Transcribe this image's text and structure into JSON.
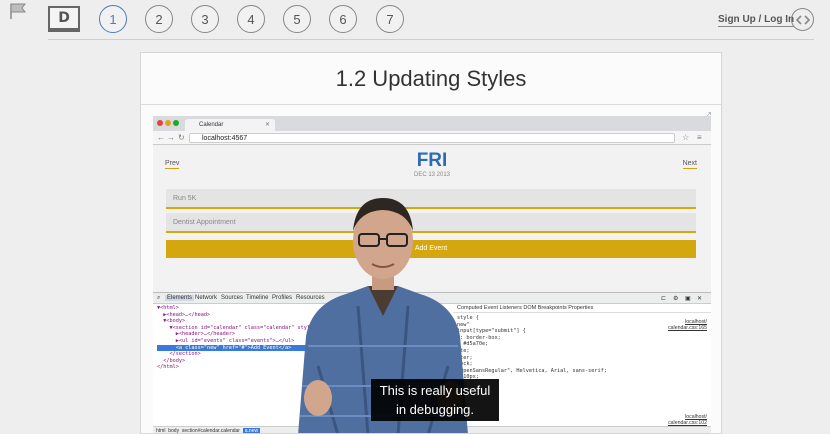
{
  "header": {
    "course_badge": "D",
    "levels": [
      "1",
      "2",
      "3",
      "4",
      "5",
      "6",
      "7"
    ],
    "active_level": "1",
    "signup_label": "Sign Up / Log In"
  },
  "lesson": {
    "title": "1.2 Updating Styles"
  },
  "browser": {
    "tab_title": "Calendar",
    "url": "localhost:4567"
  },
  "calendar_app": {
    "prev_label": "Prev",
    "next_label": "Next",
    "day": "FRI",
    "date": "DEC 13 2013",
    "events": [
      "Run 5K",
      "Dentist Appointment"
    ],
    "add_event_label": "Add Event"
  },
  "devtools": {
    "tabs": [
      "Elements",
      "Network",
      "Sources",
      "Timeline",
      "Profiles",
      "Resources"
    ],
    "active_tab": "Elements",
    "side_tabs": "Computed  Event Listeners  DOM Breakpoints  Properties",
    "dom_lines": [
      "▼<html>",
      "  ▶<head>…</head>",
      "  ▼<body>",
      "    ▼<section id=\"calendar\" class=\"calendar\" style=",
      "      ▶<header>…</header>",
      "      ▶<ul id=\"events\" class=\"events\">…</ul>",
      "      <a class=\"new\" href=\"#\">Add Event</a>",
      "    </section>",
      "  </body>",
      "</html>"
    ],
    "style_lines": [
      "style {",
      "",
      "new\"",
      "input[type=\"submit\"] {",
      "g: border-box;",
      "  #d5a70e;",
      "",
      "ite;",
      "nter;",
      "lock;",
      "\"OpenSansRegular\", Helvetica, Arial, sans-serif;",
      "x 10px;",
      "px;",
      "ase;"
    ],
    "style_links": [
      "localhost/",
      "calendar.css:165"
    ],
    "style_links_bottom": [
      "localhost/",
      "calendar.css:102"
    ],
    "breadcrumbs": [
      "html",
      "body",
      "section#calendar.calendar"
    ],
    "breadcrumb_current": "a.new"
  },
  "caption": {
    "line1": "This is really useful",
    "line2": "in debugging."
  },
  "colors": {
    "accent_blue": "#2a6cb5",
    "gold": "#d5a70e",
    "level_active": "#4f7bb4"
  }
}
